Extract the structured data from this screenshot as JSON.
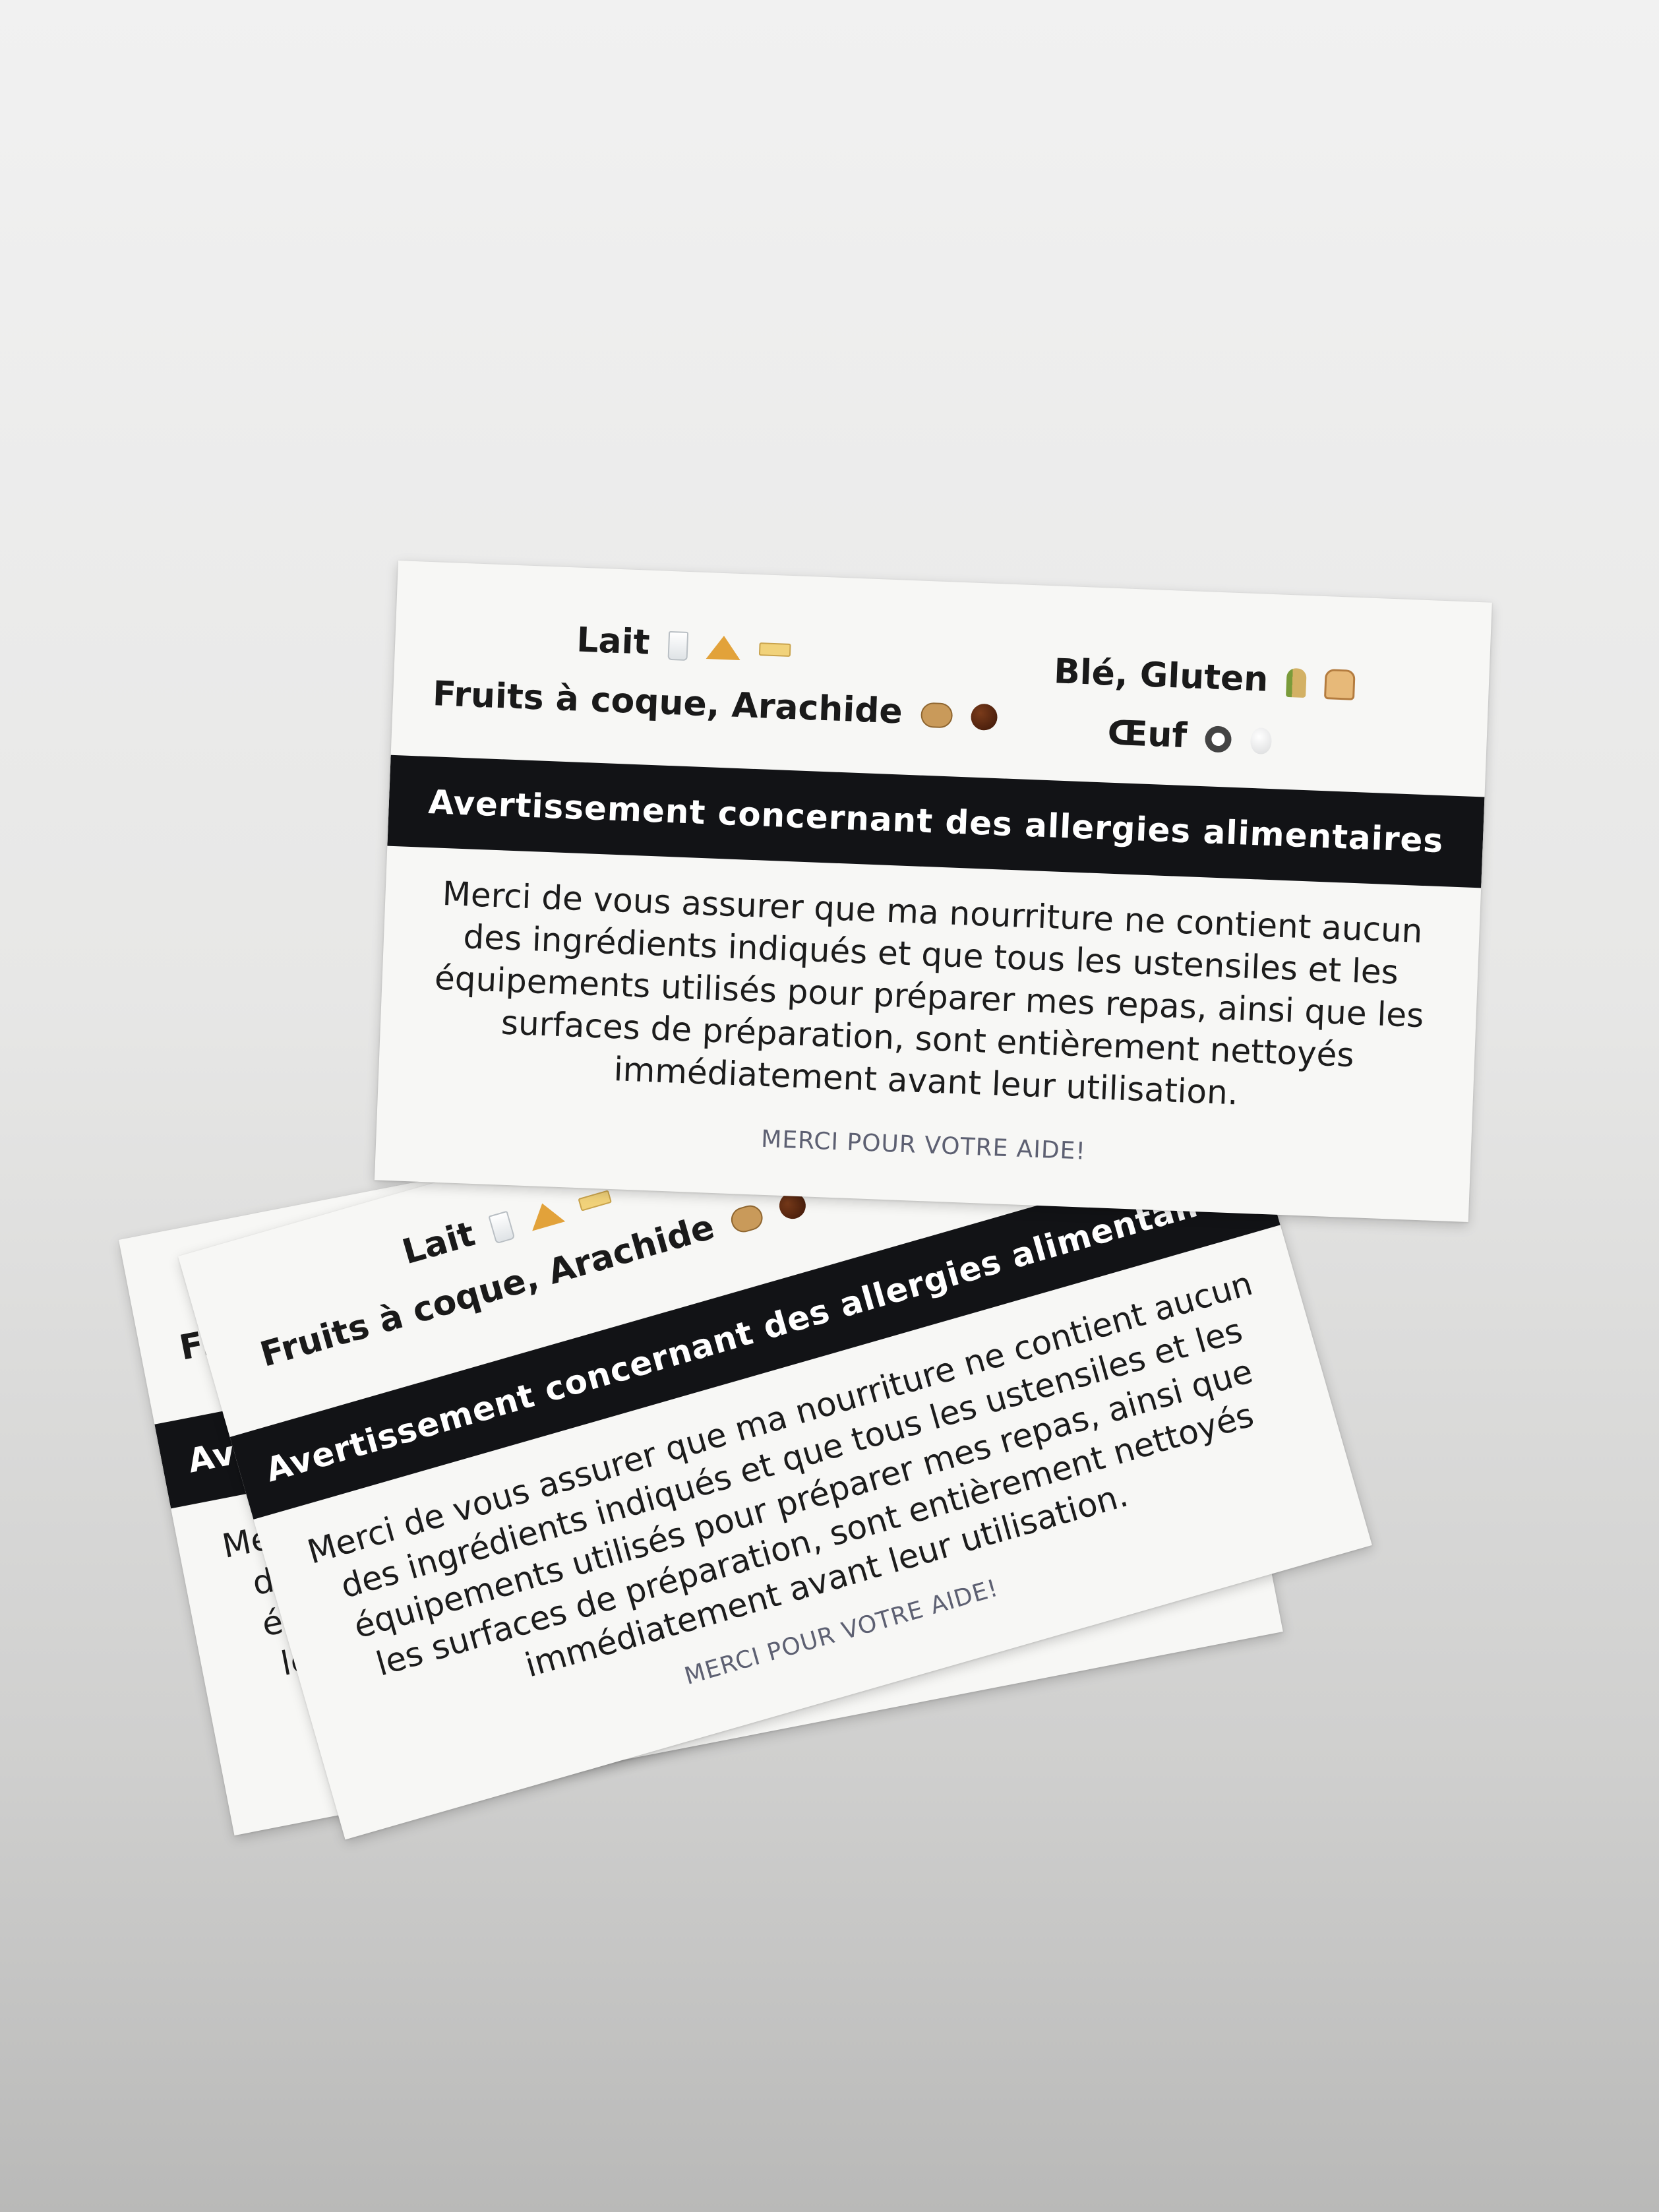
{
  "card": {
    "allergens": {
      "milk": "Lait",
      "nuts": "Fruits à coque, Arachide",
      "wheat": "Blé, Gluten",
      "egg": "Œuf"
    },
    "band_title": "Avertissement concernant des allergies alimentaires",
    "message": "Merci de vous assurer que ma nourriture ne contient aucun des ingrédients indiqués et que tous les ustensiles et les équipements utilisés pour préparer mes repas, ainsi que les surfaces de préparation, sont entièrement nettoyés immédiatement avant leur utilisation.",
    "thanks": "MERCI POUR VOTRE AIDE!"
  },
  "icons": {
    "milk": [
      "milk-glass-icon",
      "cheese-icon",
      "butter-icon"
    ],
    "nuts": [
      "peanut-icon",
      "hazelnut-icon"
    ],
    "wheat": [
      "wheat-icon",
      "bread-icon"
    ],
    "egg": [
      "fried-egg-icon",
      "egg-icon"
    ]
  },
  "colors": {
    "band": "#121316",
    "card": "#f7f7f5",
    "thanks_text": "#5d6072"
  }
}
